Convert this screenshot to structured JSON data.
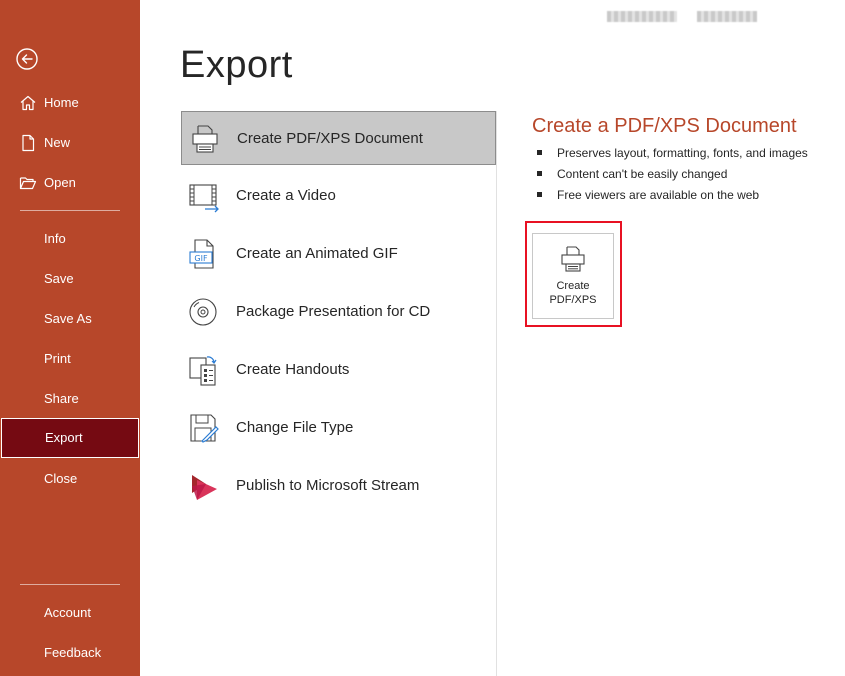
{
  "window": {
    "title_left": "",
    "title_right": ""
  },
  "sidebar": {
    "back_icon": "back-arrow-icon",
    "items": [
      {
        "label": "Home",
        "icon": "home-icon"
      },
      {
        "label": "New",
        "icon": "new-document-icon"
      },
      {
        "label": "Open",
        "icon": "folder-open-icon"
      },
      {
        "label": "Info"
      },
      {
        "label": "Save"
      },
      {
        "label": "Save As"
      },
      {
        "label": "Print"
      },
      {
        "label": "Share"
      },
      {
        "label": "Export"
      },
      {
        "label": "Close"
      },
      {
        "label": "Account"
      },
      {
        "label": "Feedback"
      }
    ],
    "selected": "Export",
    "colors": {
      "background": "#b7472a",
      "selected": "#750a12"
    }
  },
  "main": {
    "title": "Export",
    "options": [
      {
        "label": "Create PDF/XPS Document",
        "icon": "pdf-xps-icon",
        "selected": true
      },
      {
        "label": "Create a Video",
        "icon": "video-icon"
      },
      {
        "label": "Create an Animated GIF",
        "icon": "gif-icon"
      },
      {
        "label": "Package Presentation for CD",
        "icon": "cd-icon"
      },
      {
        "label": "Create Handouts",
        "icon": "handouts-icon"
      },
      {
        "label": "Change File Type",
        "icon": "change-file-type-icon"
      },
      {
        "label": "Publish to Microsoft Stream",
        "icon": "stream-icon"
      }
    ]
  },
  "detail": {
    "title": "Create a PDF/XPS Document",
    "bullets": [
      "Preserves layout, formatting, fonts, and images",
      "Content can't be easily changed",
      "Free viewers are available on the web"
    ],
    "button": {
      "line1": "Create",
      "line2": "PDF/XPS",
      "icon": "pdf-xps-icon"
    },
    "highlight_color": "#e81123",
    "accent_color": "#b7472a"
  }
}
